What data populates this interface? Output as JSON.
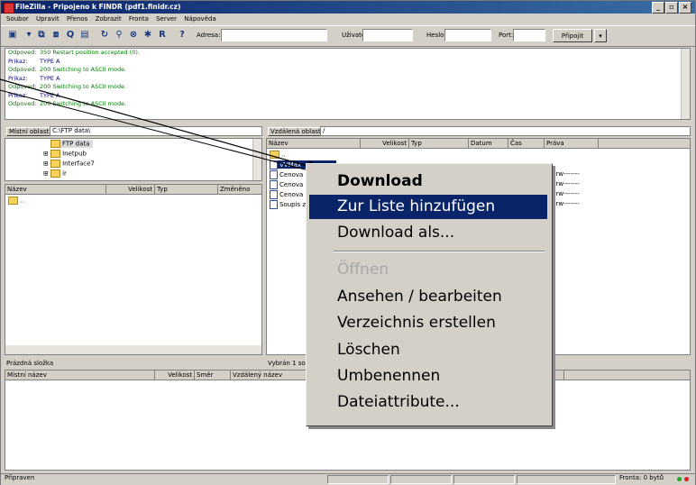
{
  "window": {
    "title": "FileZilla - Pripojeno k FINDR (pdf1.finidr.cz)"
  },
  "menu": [
    "Soubor",
    "Upravit",
    "Přenos",
    "Zobrazit",
    "Fronta",
    "Server",
    "Nápověda"
  ],
  "toolbar": {
    "address_label": "Adresa:",
    "user_label": "Uživatel:",
    "password_label": "Heslo:",
    "port_label": "Port:",
    "connect_label": "Připojit"
  },
  "log": [
    {
      "kind": "Odpoved:",
      "msg": "350 Restart position accepted (0).",
      "color": "#008000"
    },
    {
      "kind": "Prikaz:",
      "msg": "TYPE A",
      "color": "#000080"
    },
    {
      "kind": "Odpoved:",
      "msg": "200 Switching to ASCII mode.",
      "color": "#008000"
    },
    {
      "kind": "Prikaz:",
      "msg": "TYPE A",
      "color": "#000080"
    },
    {
      "kind": "Odpoved:",
      "msg": "200 Switching to ASCII mode.",
      "color": "#008000"
    },
    {
      "kind": "Prikaz:",
      "msg": "TYPE A",
      "color": "#000080"
    },
    {
      "kind": "Odpoved:",
      "msg": "200 Switching to ASCII mode.",
      "color": "#008000"
    }
  ],
  "local": {
    "label": "Místní oblast:",
    "path": "C:\\FTP data\\",
    "tree": [
      "FTP data",
      "Inetpub",
      "Interface7",
      "ir"
    ],
    "columns": [
      "Název",
      "Velikost",
      "Typ",
      "Změněno"
    ],
    "files": [
      ".."
    ],
    "status": "Prázdná složka"
  },
  "remote": {
    "label": "Vzdálená oblast:",
    "path": "/",
    "columns": [
      "Název",
      "Velikost",
      "Typ",
      "Datum",
      "Čas",
      "Práva"
    ],
    "files": [
      "..",
      "VVMax",
      "Cenova",
      "Cenova",
      "Cenova",
      "Soupis z"
    ],
    "perm": "-rw-------",
    "status": "Vybrán 1 sou"
  },
  "queue": {
    "columns": [
      "Místní název",
      "Velikost",
      "Směr",
      "Vzdálený název"
    ]
  },
  "context_menu": {
    "items": [
      "Download",
      "Zur Liste hinzufügen",
      "Download als...",
      "Öffnen",
      "Ansehen / bearbeiten",
      "Verzeichnis erstellen",
      "Löschen",
      "Umbenennen",
      "Dateiattribute..."
    ]
  },
  "statusbar": {
    "left": "Připraven",
    "right": "Fronta: 0 bytů"
  }
}
